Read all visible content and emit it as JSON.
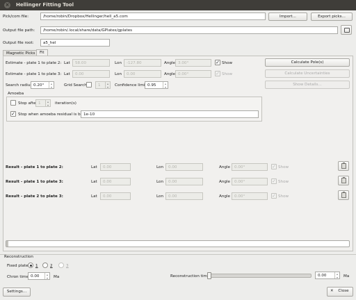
{
  "window": {
    "title": "Hellinger Fitting Tool"
  },
  "top": {
    "pickcom_label": "Pick/com file:",
    "pickcom_value": "/home/robin/Dropbox/Hellinger/hell_a5.com",
    "import_label": "Import...",
    "export_label": "Export picks...",
    "output_path_label": "Output file path:",
    "output_path_value": "/home/robin/.local/share/data/GPlates/gplates",
    "output_root_label": "Output file root:",
    "output_root_value": "a5_hel"
  },
  "tabs": [
    {
      "label": "Magnetic Picks"
    },
    {
      "label": "Fit"
    }
  ],
  "fit": {
    "est12_label": "Estimate - plate 1 to plate 2:",
    "est13_label": "Estimate - plate 1 to plate 3:",
    "lat_label": "Lat",
    "lon_label": "Lon",
    "angle_label": "Angle",
    "show_label": "Show",
    "est12": {
      "lat": "58.00",
      "lon": "-127.80",
      "angle": "3.00°"
    },
    "est13": {
      "lat": "0.00",
      "lon": "0.00",
      "angle": "0.00°"
    },
    "calc_poles_label": "Calculate Pole(s)",
    "calc_unc_label": "Calculate Uncertainties",
    "show_details_label": "Show Details...",
    "search_radius_label": "Search radius",
    "search_radius_value": "0.20°",
    "grid_search_label": "Grid Search",
    "grid_search_value": "1",
    "confidence_label": "Confidence limit",
    "confidence_value": "0.95",
    "amoeba_title": "Amoeba",
    "stop_after_label": "Stop after",
    "stop_after_value": "1",
    "iterations_label": "iteration(s)",
    "stop_residual_label": "Stop when amoeba residual is below",
    "residual_value": "1e-10"
  },
  "results": [
    {
      "label": "Result - plate 1 to plate 2:",
      "lat": "0.00",
      "lon": "0.00",
      "angle": "0.00°"
    },
    {
      "label": "Result - plate 1 to plate 3:",
      "lat": "0.00",
      "lon": "0.00",
      "angle": "0.00°"
    },
    {
      "label": "Result - plate 2 to plate 3:",
      "lat": "0.00",
      "lon": "0.00",
      "angle": "0.00°"
    }
  ],
  "reconstruction": {
    "title": "Reconstruction",
    "fixed_plate_label": "Fixed plate",
    "radio1": "1",
    "radio2": "2",
    "radio3": "3",
    "chron_label": "Chron time",
    "chron_value": "0.00",
    "ma": "Ma",
    "recon_time_label": "Reconstruction time",
    "recon_time_value": "0.00"
  },
  "footer": {
    "settings_label": "Settings...",
    "close_label": "Close"
  }
}
